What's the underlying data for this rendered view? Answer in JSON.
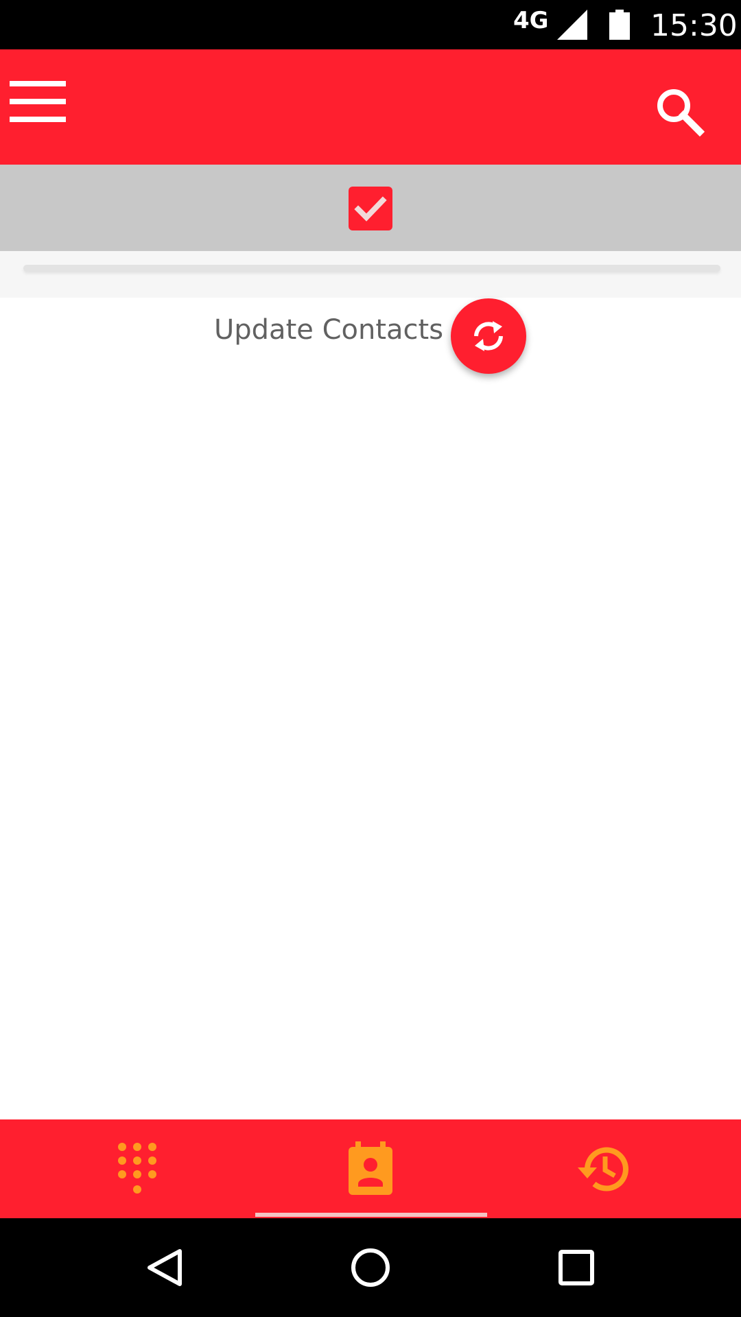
{
  "status_bar": {
    "network": "4G",
    "time": "15:30"
  },
  "app_bar": {
    "menu_icon": "menu-icon",
    "search_icon": "search-icon",
    "color": "#ff1f2f"
  },
  "select_strip": {
    "checkbox_checked": true,
    "checkbox_icon": "checkbox-checked-icon"
  },
  "progress": {
    "value": 0
  },
  "update": {
    "label": "Update Contacts",
    "icon": "sync-icon"
  },
  "bottom_nav": {
    "tabs": [
      {
        "icon": "dialpad-icon",
        "active": false
      },
      {
        "icon": "contacts-icon",
        "active": true
      },
      {
        "icon": "history-icon",
        "active": false
      }
    ],
    "icon_color": "#ff9a1f",
    "indicator_color": "#f3c4c4"
  },
  "system_nav": {
    "buttons": [
      "back-icon",
      "home-icon",
      "recents-icon"
    ]
  }
}
